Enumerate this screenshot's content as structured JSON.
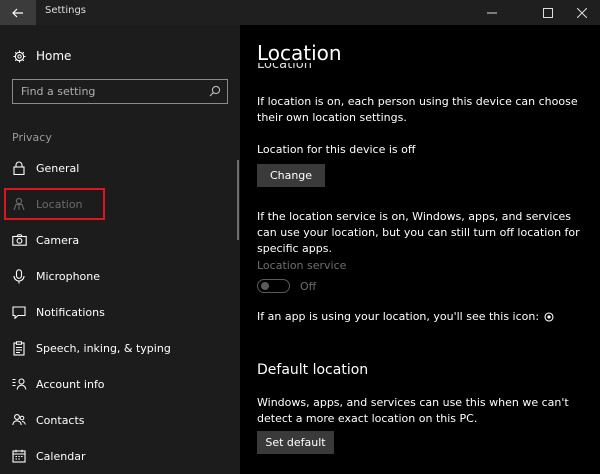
{
  "window": {
    "title": "Settings",
    "back_icon": "arrow-left-icon",
    "minimize_icon": "minimize-icon",
    "maximize_icon": "maximize-icon",
    "close_icon": "close-icon"
  },
  "sidebar": {
    "home_label": "Home",
    "search_placeholder": "Find a setting",
    "section_label": "Privacy",
    "items": [
      {
        "label": "General",
        "icon": "lock-icon"
      },
      {
        "label": "Location",
        "icon": "location-person-icon",
        "selected": true
      },
      {
        "label": "Camera",
        "icon": "camera-icon"
      },
      {
        "label": "Microphone",
        "icon": "microphone-icon"
      },
      {
        "label": "Notifications",
        "icon": "notification-icon"
      },
      {
        "label": "Speech, inking, & typing",
        "icon": "clipboard-icon"
      },
      {
        "label": "Account info",
        "icon": "account-info-icon"
      },
      {
        "label": "Contacts",
        "icon": "contacts-icon"
      },
      {
        "label": "Calendar",
        "icon": "calendar-icon"
      }
    ]
  },
  "content": {
    "page_title": "Location",
    "ghost_heading": "Location",
    "intro": "If location is on, each person using this device can choose their own location settings.",
    "device_status": "Location for this device is off",
    "change_button": "Change",
    "service_text": "If the location service is on, Windows, apps, and services can use your location, but you can still turn off location for specific apps.",
    "service_label": "Location service",
    "service_state": "Off",
    "icon_text": "If an app is using your location, you'll see this icon:",
    "default_heading": "Default location",
    "default_text": "Windows, apps, and services can use this when we can't detect a more exact location on this PC.",
    "set_default_button": "Set default"
  },
  "colors": {
    "sidebar_bg": "#1c1c1c",
    "content_bg": "#000000",
    "button_bg": "#3a3a3a",
    "highlight": "#e0141e"
  }
}
